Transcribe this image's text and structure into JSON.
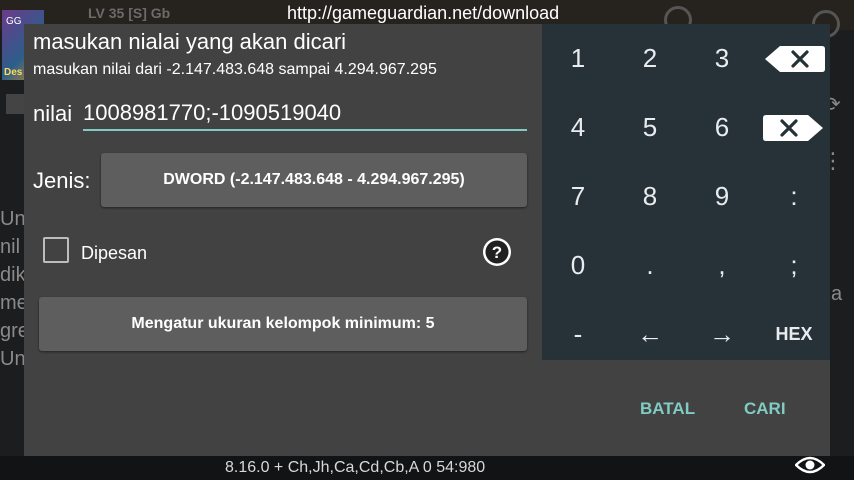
{
  "background": {
    "url_banner": "http://gameguardian.net/download",
    "level_text": "LV 35 [S] Gb",
    "side_text_lines": [
      "Un",
      "nil",
      "dik",
      "me",
      "gre",
      "Un"
    ],
    "right_text": "a",
    "status_line": "8.16.0  +  Ch,Jh,Ca,Cd,Cb,A    0  54:980",
    "icons": [
      "eye-icon",
      "menu-icon",
      "refresh-icon"
    ]
  },
  "dialog": {
    "title": "masukan nialai yang akan dicari",
    "subtitle": "masukan nilai dari -2.147.483.648 sampai 4.294.967.295",
    "value_prefix": "nilai",
    "value": "1008981770;-1090519040",
    "type_label": "Jenis:",
    "type_value": "DWORD (-2.147.483.648 - 4.294.967.295)",
    "ordered_label": "Dipesan",
    "ordered_checked": false,
    "group_size_button": "Mengatur ukuran kelompok minimum: 5",
    "cancel_label": "BATAL",
    "search_label": "CARI",
    "accent_color": "#80cbc4"
  },
  "keypad": {
    "keys": [
      [
        "1",
        "2",
        "3",
        "backspace"
      ],
      [
        "4",
        "5",
        "6",
        "delete"
      ],
      [
        "7",
        "8",
        "9",
        ":"
      ],
      [
        "0",
        ".",
        ",",
        ";"
      ],
      [
        "-",
        "←",
        "→",
        "HEX"
      ]
    ],
    "row1": {
      "k1": "1",
      "k2": "2",
      "k3": "3"
    },
    "row2": {
      "k1": "4",
      "k2": "5",
      "k3": "6"
    },
    "row3": {
      "k1": "7",
      "k2": "8",
      "k3": "9",
      "k4": ":"
    },
    "row4": {
      "k1": "0",
      "k2": ".",
      "k3": ",",
      "k4": ";"
    },
    "row5": {
      "k1": "-",
      "k2": "←",
      "k3": "→",
      "k4": "HEX"
    }
  }
}
